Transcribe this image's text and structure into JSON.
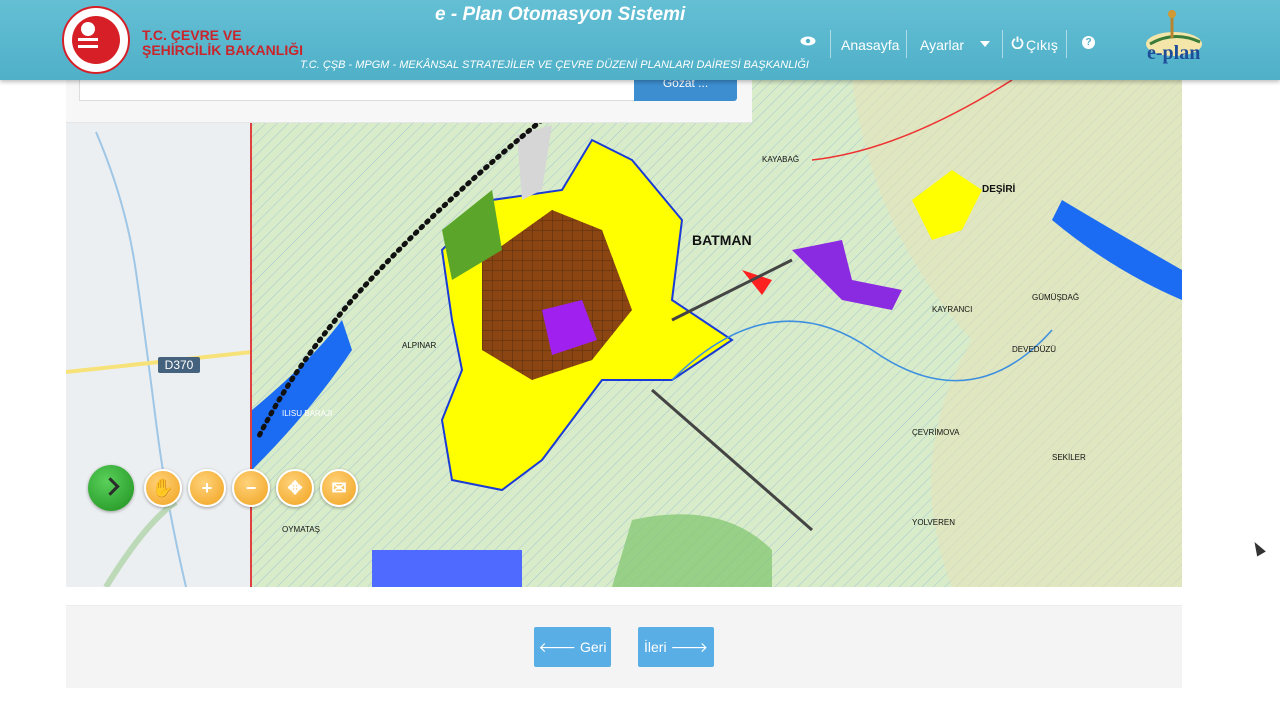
{
  "header": {
    "ministry_line1": "T.C. ÇEVRE VE",
    "ministry_line2": "ŞEHİRCİLİK BAKANLIĞI",
    "system_title": "e - Plan Otomasyon Sistemi",
    "subtitle": "T.C. ÇŞB - MPGM - MEKÂNSAL STRATEJİLER VE ÇEVRE DÜZENİ PLANLARI DAİRESİ BAŞKANLIĞI",
    "nav": {
      "home": "Anasayfa",
      "settings": "Ayarlar",
      "logout": "Çıkış",
      "help": "?"
    },
    "app_logo": "e-plan"
  },
  "upload": {
    "browse_label": "Gözat ..."
  },
  "map": {
    "road_label": "D370",
    "place_labels": [
      "BATMAN",
      "DEŞİRİ",
      "ALPINAR",
      "KAYABAĞ",
      "ÇEVRİMOVA",
      "YOLVEREN",
      "OYMATAŞ",
      "DEVEDÜZÜ",
      "SEKİLER",
      "ILISU BARAJI",
      "KAYRANCI",
      "GÜMÜŞDAĞ"
    ],
    "tools": [
      "go-icon",
      "pan-hand-icon",
      "zoom-in-icon",
      "zoom-out-icon",
      "full-extent-icon",
      "clear-icon"
    ]
  },
  "footer": {
    "back_label": "Geri",
    "next_label": "İleri"
  },
  "colors": {
    "header_bg": "#56b5cc",
    "ministry_red": "#c9252c",
    "button_blue": "#5aaee6"
  }
}
